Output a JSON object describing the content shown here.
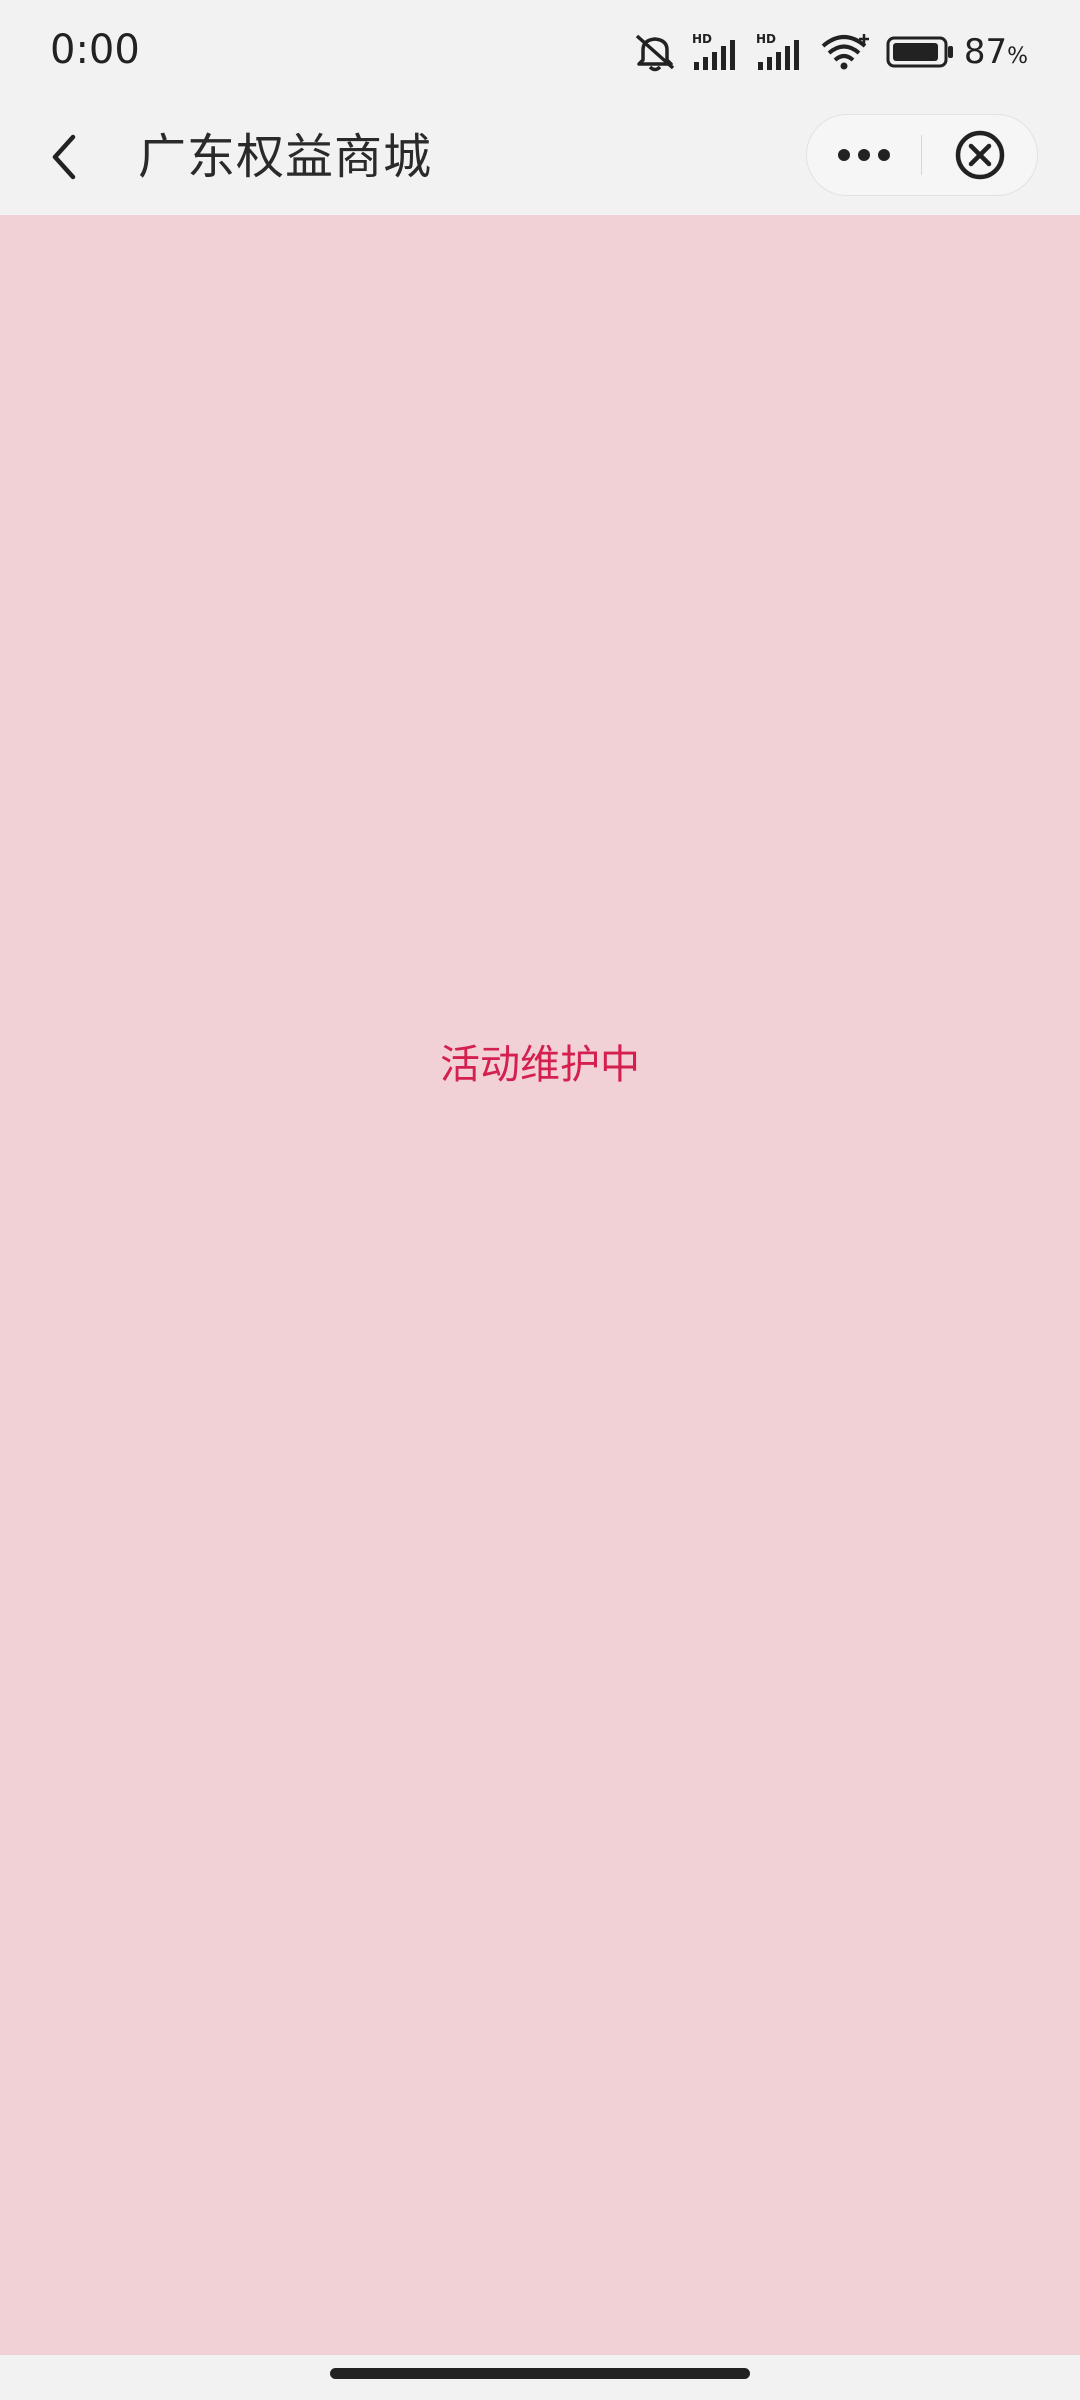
{
  "status_bar": {
    "time": "0:00",
    "battery_percent": "87",
    "battery_unit": "%",
    "icons": [
      "mute-icon",
      "signal-hd-icon",
      "signal-hd-icon",
      "wifi-icon",
      "battery-icon"
    ]
  },
  "nav": {
    "title": "广东权益商城",
    "back_icon": "chevron-left-icon",
    "more_icon": "more-dots-icon",
    "close_icon": "close-circle-icon"
  },
  "main": {
    "message": "活动维护中",
    "background_color": "#f2d1d6",
    "message_color": "#d4204f"
  }
}
